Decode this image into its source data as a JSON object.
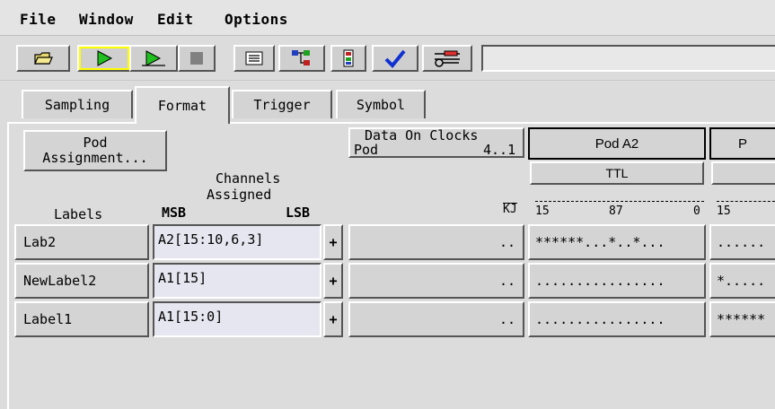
{
  "menu": {
    "file": "File",
    "window": "Window",
    "edit": "Edit",
    "options": "Options"
  },
  "toolbar": {
    "input_value": ""
  },
  "tabs": [
    {
      "label": "Sampling"
    },
    {
      "label": "Format"
    },
    {
      "label": "Trigger"
    },
    {
      "label": "Symbol"
    }
  ],
  "format": {
    "pod_assignment_line1": "Pod",
    "pod_assignment_line2": "Assignment...",
    "channels_line1": "Channels",
    "channels_line2": "Assigned",
    "labels_header": "Labels",
    "msb": "MSB",
    "lsb": "LSB",
    "data_on_clocks_line1": "Data On Clocks",
    "data_on_clocks_pod": "Pod",
    "data_on_clocks_range": "4..1",
    "kj": "KJ",
    "pod_a2": "Pod A2",
    "pod_a2_threshold": "TTL",
    "pod_next": "P",
    "bit_scale_a2_15": "15",
    "bit_scale_a2_87": "87",
    "bit_scale_a2_0": "0",
    "bit_scale_next_15": "15"
  },
  "rows": [
    {
      "label": "Lab2",
      "channels": "A2[15:10,6,3]",
      "plus": "+",
      "clocks": "..",
      "pod_a2": "******...*..*...",
      "pod_next": "......"
    },
    {
      "label": "NewLabel2",
      "channels": "A1[15]",
      "plus": "+",
      "clocks": "..",
      "pod_a2": "................",
      "pod_next": "*....."
    },
    {
      "label": "Label1",
      "channels": "A1[15:0]",
      "plus": "+",
      "clocks": "..",
      "pod_a2": "................",
      "pod_next": "******"
    }
  ]
}
